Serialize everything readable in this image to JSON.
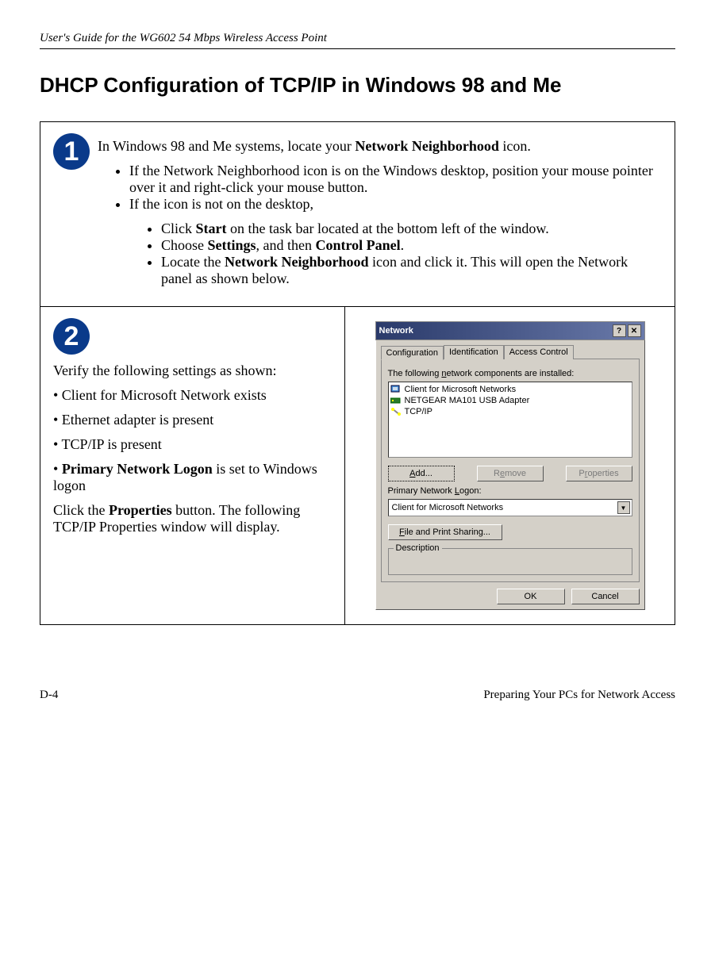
{
  "header": "User's Guide for the WG602 54 Mbps Wireless Access Point",
  "title": "DHCP Configuration of TCP/IP in Windows 98 and Me",
  "step1": {
    "badge": "1",
    "intro_pre": "In Windows 98 and Me systems, locate your ",
    "intro_bold": "Network Neighborhood",
    "intro_post": " icon.",
    "b1": "If the Network Neighborhood icon is on the Windows desktop, position your mouse pointer over it and right-click your mouse button.",
    "b2": "If the icon is not on the desktop,",
    "s1_pre": "Click ",
    "s1_bold": "Start",
    "s1_post": " on the task bar located at the bottom left of the window.",
    "s2_pre": "Choose ",
    "s2_bold1": "Settings",
    "s2_mid": ", and then ",
    "s2_bold2": "Control Panel",
    "s2_post": ".",
    "s3_pre": "Locate the ",
    "s3_bold": "Network Neighborhood",
    "s3_post": " icon and click it. This will open the Network panel as shown below."
  },
  "step2": {
    "badge": "2",
    "verify": "Verify the following settings as shown:",
    "v1": "• Client for Microsoft Network exists",
    "v2": "• Ethernet adapter is present",
    "v3": "• TCP/IP is present",
    "v4_pre": "• ",
    "v4_bold": "Primary Network Logon",
    "v4_post": " is set to Windows logon",
    "click_pre": "Click the ",
    "click_bold": "Properties",
    "click_post": " button. The following TCP/IP Properties window will display."
  },
  "dialog": {
    "title": "Network",
    "tab1": "Configuration",
    "tab2": "Identification",
    "tab3": "Access Control",
    "list_label_pre": "The following ",
    "list_label_u": "n",
    "list_label_post": "etwork components are installed:",
    "item1": "Client for Microsoft Networks",
    "item2": "NETGEAR MA101 USB Adapter",
    "item3": "TCP/IP",
    "add_u": "A",
    "add_post": "dd...",
    "remove_pre": "R",
    "remove_u": "e",
    "remove_post": "move",
    "prop_pre": "P",
    "prop_u": "r",
    "prop_post": "operties",
    "logon_pre": "Primary Network ",
    "logon_u": "L",
    "logon_post": "ogon:",
    "combo": "Client for Microsoft Networks",
    "fps_u": "F",
    "fps_post": "ile and Print Sharing...",
    "desc": "Description",
    "ok": "OK",
    "cancel": "Cancel"
  },
  "footer": {
    "left": "D-4",
    "right": "Preparing Your PCs for Network Access"
  }
}
